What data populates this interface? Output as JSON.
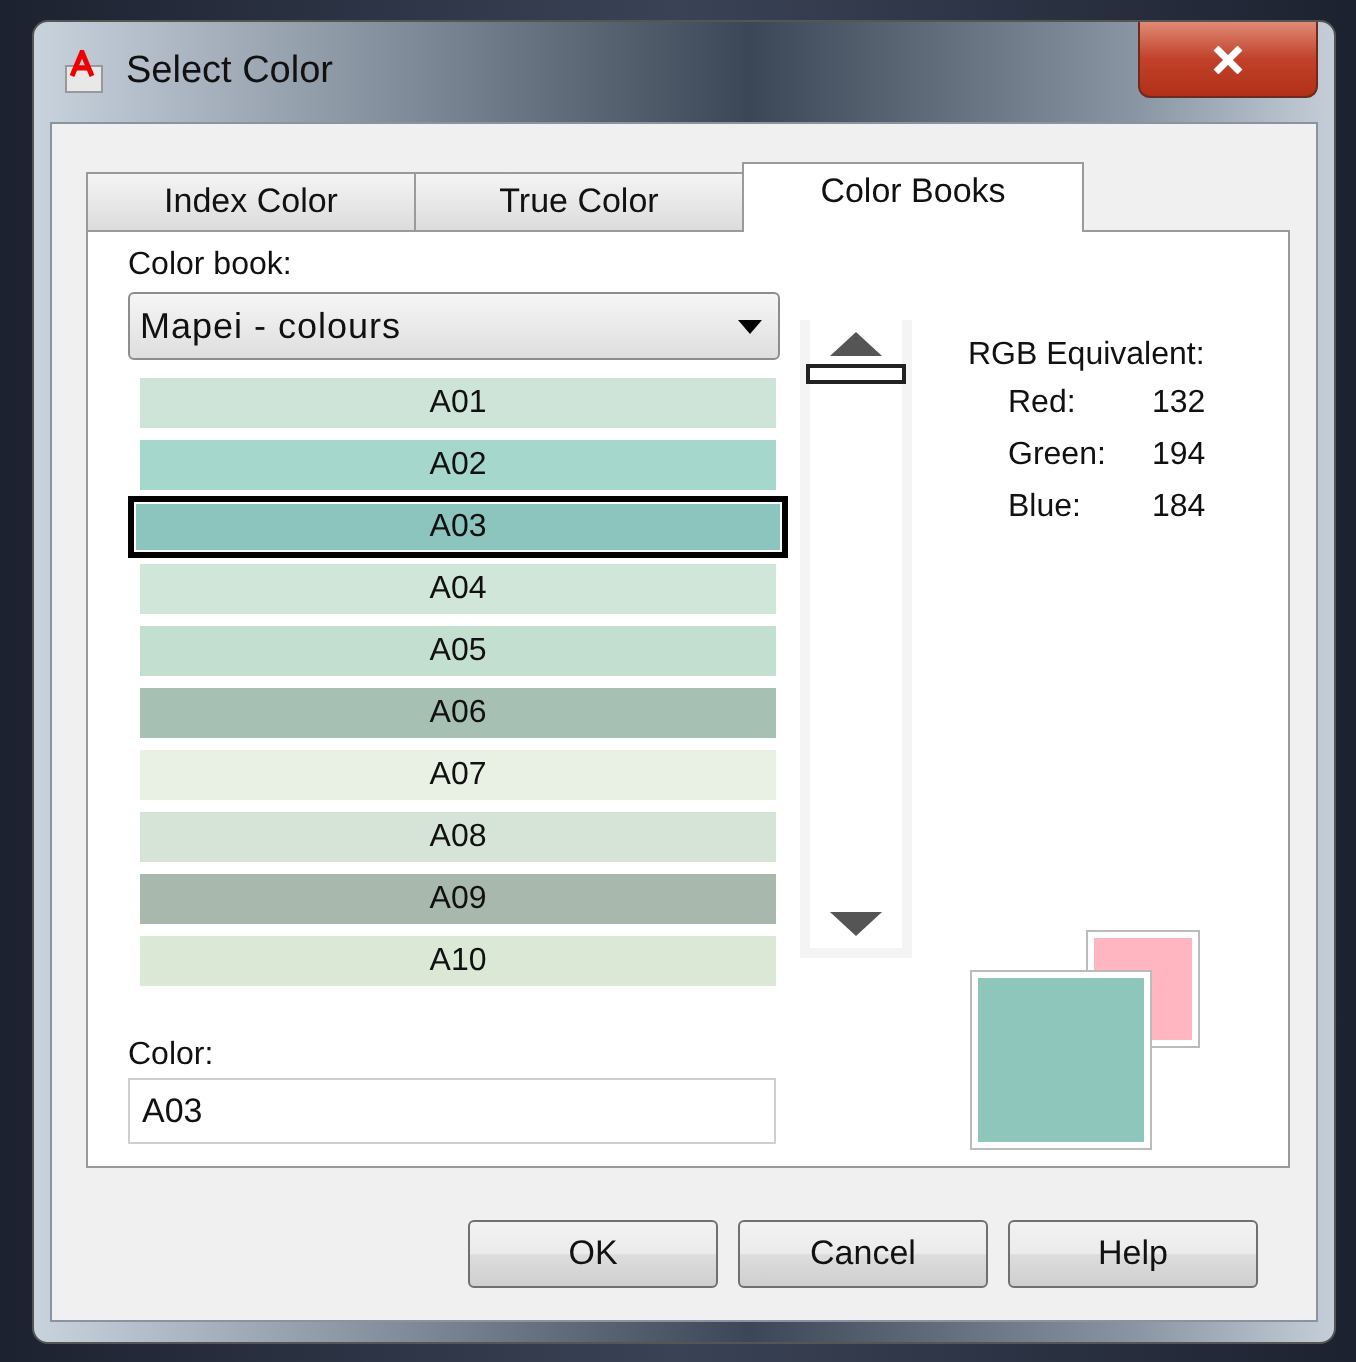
{
  "window": {
    "title": "Select Color"
  },
  "tabs": [
    {
      "label": "Index Color",
      "selected": false
    },
    {
      "label": "True Color",
      "selected": false
    },
    {
      "label": "Color Books",
      "selected": true
    }
  ],
  "color_book": {
    "label": "Color book:",
    "value": "Mapei - colours"
  },
  "swatches": [
    {
      "name": "A01",
      "color": "#cfe4d9",
      "selected": false
    },
    {
      "name": "A02",
      "color": "#a5d7cc",
      "selected": false
    },
    {
      "name": "A03",
      "color": "#8cc5bd",
      "selected": true
    },
    {
      "name": "A04",
      "color": "#cfe6d8",
      "selected": false
    },
    {
      "name": "A05",
      "color": "#c3dfcf",
      "selected": false
    },
    {
      "name": "A06",
      "color": "#a6c1b3",
      "selected": false
    },
    {
      "name": "A07",
      "color": "#e9f1e5",
      "selected": false
    },
    {
      "name": "A08",
      "color": "#d6e4d7",
      "selected": false
    },
    {
      "name": "A09",
      "color": "#a8b8ac",
      "selected": false
    },
    {
      "name": "A10",
      "color": "#dbe8d6",
      "selected": false
    }
  ],
  "rgb": {
    "title": "RGB Equivalent:",
    "rows": [
      {
        "label": "Red:",
        "value": "132"
      },
      {
        "label": "Green:",
        "value": "194"
      },
      {
        "label": "Blue:",
        "value": "184"
      }
    ]
  },
  "color_field": {
    "label": "Color:",
    "value": "A03"
  },
  "preview": [
    {
      "kind": "old",
      "color": "#ffb6c1"
    },
    {
      "kind": "new",
      "color": "#8fc6bb"
    }
  ],
  "buttons": [
    "OK",
    "Cancel",
    "Help"
  ]
}
